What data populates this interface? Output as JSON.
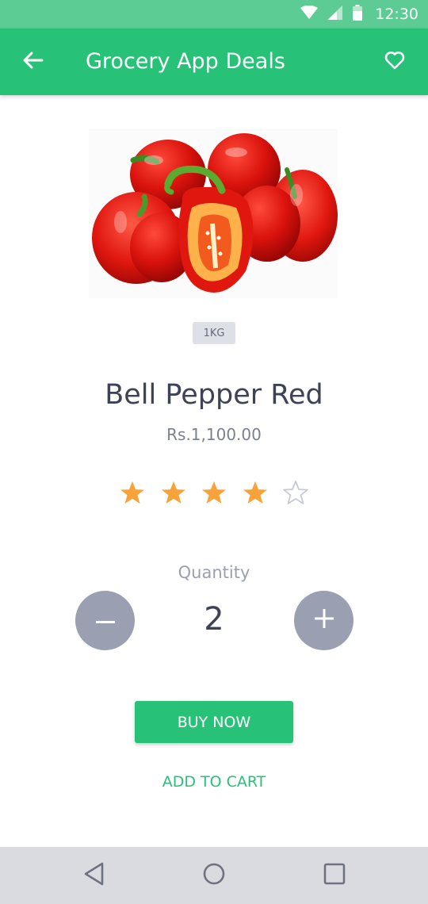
{
  "status_bar": {
    "time": "12:30",
    "icons": [
      "wifi-icon",
      "signal-icon",
      "battery-icon"
    ]
  },
  "app_bar": {
    "title": "Grocery App Deals",
    "left_icon": "back-arrow-icon",
    "right_icon": "heart-icon",
    "color": "#27c278"
  },
  "product": {
    "image": "red-bell-peppers-image",
    "size": "1KG",
    "name": "Bell Pepper Red",
    "price": "Rs.1,100.00",
    "rating": 4,
    "rating_max": 5
  },
  "quantity": {
    "label": "Quantity",
    "value": "2",
    "decrease_icon": "minus-icon",
    "increase_icon": "plus-icon"
  },
  "actions": {
    "buy_now": "BUY NOW",
    "add_to_cart": "ADD TO CART"
  },
  "nav_bar": {
    "icons": [
      "back-triangle-icon",
      "home-circle-icon",
      "recents-square-icon"
    ]
  },
  "colors": {
    "accent": "#27c278",
    "star_filled": "#f7a33a",
    "star_empty": "#c7cad2"
  }
}
